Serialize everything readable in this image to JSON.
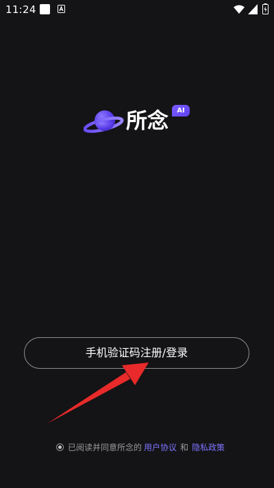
{
  "status_bar": {
    "time": "11:24"
  },
  "app": {
    "name": "所念",
    "badge": "AI"
  },
  "login": {
    "button_label": "手机验证码注册/登录"
  },
  "agreement": {
    "prefix": "已阅读并同意所念的",
    "user_agreement": "用户协议",
    "and": "和",
    "privacy_policy": "隐私政策"
  },
  "colors": {
    "background": "#141316",
    "accent": "#7d75ff",
    "planet": "#6a4cf5",
    "arrow": "#e82a2a"
  },
  "icons": [
    "app-notification-icon",
    "a-notification-icon",
    "wifi-icon",
    "signal-icon",
    "battery-icon",
    "planet-logo-icon",
    "radio-icon",
    "arrow-annotation"
  ]
}
